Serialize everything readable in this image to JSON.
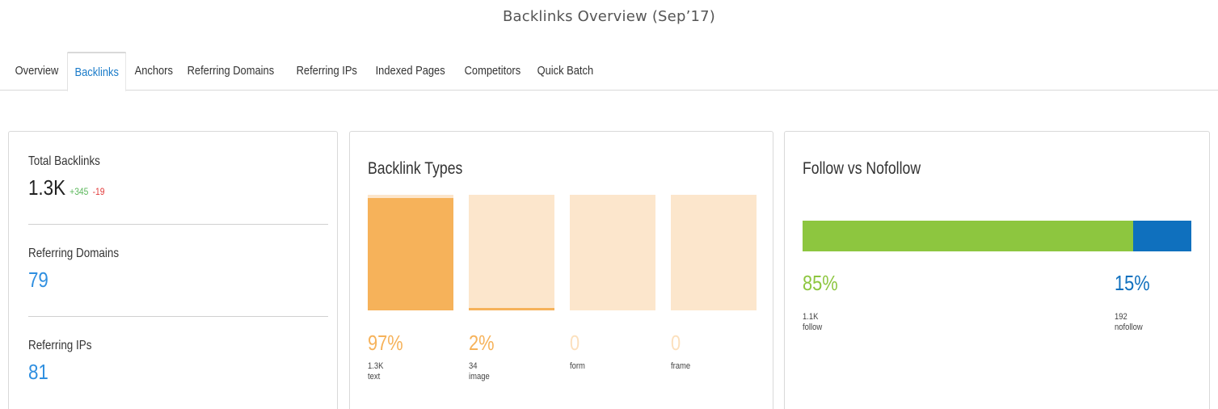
{
  "page_title": "Backlinks Overview (Sep’17)",
  "tabs": [
    {
      "label": "Overview",
      "active": false
    },
    {
      "label": "Backlinks",
      "active": true
    },
    {
      "label": "Anchors",
      "active": false
    },
    {
      "label": "Referring Domains",
      "active": false
    },
    {
      "label": "Referring IPs",
      "active": false
    },
    {
      "label": "Indexed Pages",
      "active": false
    },
    {
      "label": "Competitors",
      "active": false
    },
    {
      "label": "Quick Batch",
      "active": false
    }
  ],
  "summary": {
    "total_backlinks": {
      "label": "Total Backlinks",
      "value": "1.3K",
      "delta_up": "+345",
      "delta_down": "-19"
    },
    "referring_domains": {
      "label": "Referring Domains",
      "value": "79"
    },
    "referring_ips": {
      "label": "Referring IPs",
      "value": "81"
    }
  },
  "backlink_types": {
    "title": "Backlink Types",
    "items": [
      {
        "pct": "97%",
        "count": "1.3K",
        "type": "text",
        "fraction": 0.97
      },
      {
        "pct": "2%",
        "count": "34",
        "type": "image",
        "fraction": 0.02
      },
      {
        "pct": "0",
        "count": "",
        "type": "form",
        "fraction": 0
      },
      {
        "pct": "0",
        "count": "",
        "type": "frame",
        "fraction": 0
      }
    ]
  },
  "follow_nofollow": {
    "title": "Follow vs Nofollow",
    "follow": {
      "pct": "85%",
      "count": "1.1K",
      "label": "follow",
      "fraction": 0.85
    },
    "nofollow": {
      "pct": "15%",
      "count": "192",
      "label": "nofollow",
      "fraction": 0.15
    }
  },
  "colors": {
    "accent_blue": "#2f8fe0",
    "bar_orange": "#f6b25a",
    "bar_orange_light": "#fce6cc",
    "follow_green": "#8dc63f",
    "nofollow_blue": "#0f70be",
    "delta_positive": "#5cb85c",
    "delta_negative": "#e23b3b"
  }
}
